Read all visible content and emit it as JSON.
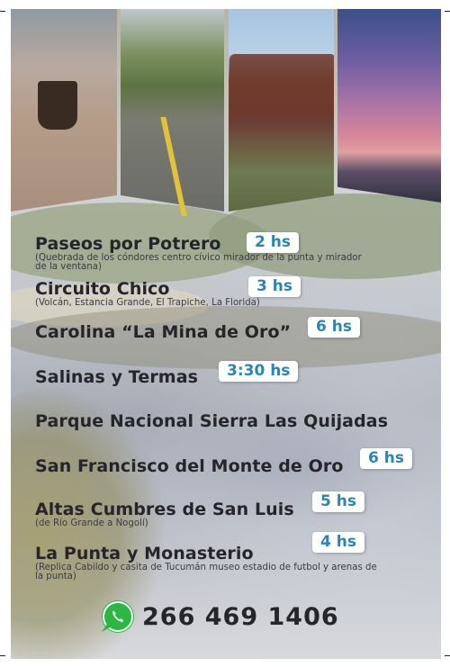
{
  "items": [
    {
      "title": "Paseos por Potrero",
      "duration": "2 hs",
      "detail": "(Quebrada de los cóndores centro cívico mirador de la punta y mirador de la ventana)"
    },
    {
      "title": "Circuito Chico",
      "duration": "3 hs",
      "detail": "(Volcán, Estancia Grande, El Trapiche, La Florida)"
    },
    {
      "title": "Carolina “La Mina de Oro”",
      "duration": "6 hs",
      "detail": ""
    },
    {
      "title": "Salinas y Termas",
      "duration": "3:30 hs",
      "detail": ""
    },
    {
      "title": "Parque Nacional Sierra Las Quijadas",
      "duration": "",
      "detail": ""
    },
    {
      "title": "San Francisco del Monte de Oro",
      "duration": "6 hs",
      "detail": ""
    },
    {
      "title": "Altas Cumbres de San Luis",
      "duration": "5 hs",
      "detail": "(de Río Grande a Nogolí)"
    },
    {
      "title": "La Punta y Monasterio",
      "duration": "4 hs",
      "detail": "(Replica Cabildo y casita de Tucumán museo estadio de futbol y arenas de la punta)"
    }
  ],
  "contact": {
    "icon": "whatsapp-icon",
    "phone": "266 469 1406"
  },
  "colors": {
    "badge_text": "#2c84b6",
    "title_text": "#26252a",
    "whatsapp_green": "#2bb741"
  }
}
